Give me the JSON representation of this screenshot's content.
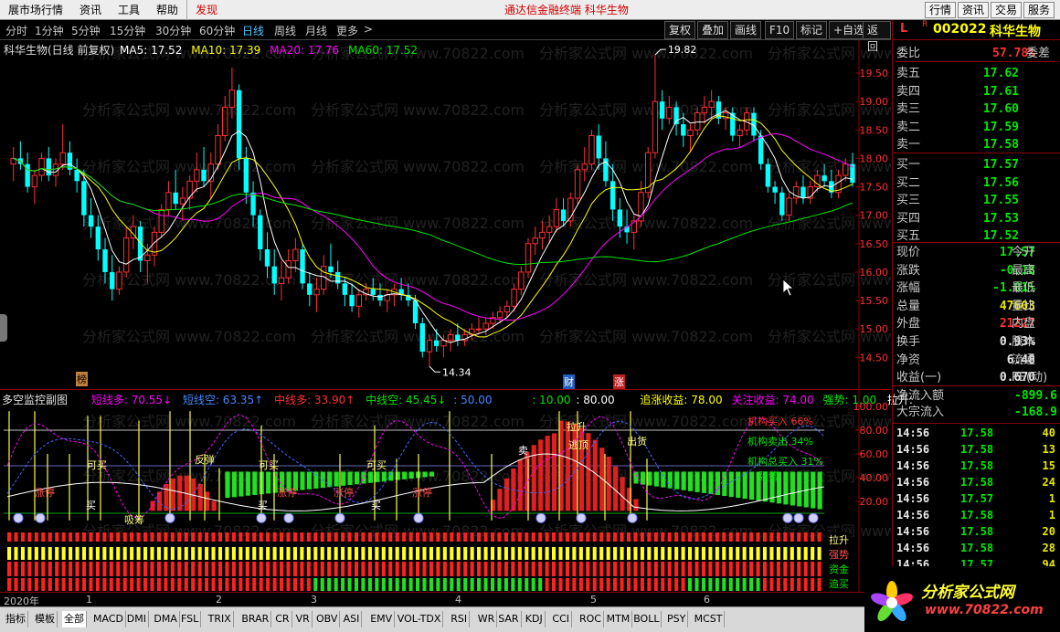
{
  "menubar": {
    "items": [
      "展市场行情",
      "资讯",
      "工具",
      "帮助"
    ],
    "discover": "发现",
    "center_title": "通达信金融终端   科华生物",
    "right_buttons": [
      "行情",
      "资讯",
      "交易",
      "服务"
    ]
  },
  "periods": {
    "items": [
      "分时",
      "1分钟",
      "5分钟",
      "15分钟",
      "30分钟",
      "60分钟",
      "日线",
      "周线",
      "月线",
      "更多"
    ],
    "active": "日线",
    "chevron": ">",
    "toolbar": [
      "复权",
      "叠加",
      "画线",
      "F10",
      "标记",
      "+自选",
      "返回"
    ]
  },
  "main_chart": {
    "title": "科华生物(日线 前复权)",
    "ma": [
      {
        "label": "MA5: 17.52",
        "color": "#ffffff"
      },
      {
        "label": "MA10: 17.39",
        "color": "#ffff00"
      },
      {
        "label": "MA20: 17.76",
        "color": "#ff00ff"
      },
      {
        "label": "MA60: 17.52",
        "color": "#00e600"
      }
    ],
    "max_label": "19.82",
    "min_label": "14.34",
    "y_ticks": [
      "19.50",
      "19.00",
      "18.50",
      "18.00",
      "17.50",
      "17.00",
      "16.50",
      "16.00",
      "15.50",
      "15.00",
      "14.50"
    ],
    "markers": [
      "榜",
      "财",
      "涨"
    ]
  },
  "chart_data": {
    "type": "candlestick",
    "title": "科华生物(日线 前复权)",
    "ylim": [
      14.2,
      19.95
    ],
    "y_ticks": [
      19.5,
      19.0,
      18.5,
      18.0,
      17.5,
      17.0,
      16.5,
      16.0,
      15.5,
      15.0,
      14.5
    ],
    "x_labels": [
      "2020年",
      "1",
      "2",
      "3",
      "4",
      "5",
      "6"
    ],
    "high": 19.82,
    "low": 14.34,
    "ohlc": [
      [
        17.9,
        18.2,
        17.6,
        18.0
      ],
      [
        18.0,
        18.3,
        17.8,
        17.9
      ],
      [
        17.9,
        18.1,
        17.4,
        17.5
      ],
      [
        17.5,
        17.8,
        17.2,
        17.7
      ],
      [
        17.7,
        18.1,
        17.6,
        18.0
      ],
      [
        18.0,
        18.2,
        17.6,
        17.7
      ],
      [
        17.7,
        18.0,
        17.5,
        17.9
      ],
      [
        17.9,
        18.6,
        17.8,
        18.1
      ],
      [
        18.1,
        18.3,
        17.7,
        17.8
      ],
      [
        17.8,
        18.0,
        17.4,
        17.6
      ],
      [
        17.6,
        17.8,
        16.8,
        17.0
      ],
      [
        17.0,
        17.3,
        16.6,
        16.8
      ],
      [
        16.8,
        17.0,
        16.2,
        16.4
      ],
      [
        16.4,
        16.6,
        15.8,
        16.0
      ],
      [
        16.0,
        16.3,
        15.5,
        15.7
      ],
      [
        15.7,
        16.1,
        15.6,
        16.0
      ],
      [
        16.0,
        16.8,
        15.9,
        16.6
      ],
      [
        16.6,
        17.0,
        16.4,
        16.8
      ],
      [
        16.8,
        16.9,
        16.0,
        16.2
      ],
      [
        16.2,
        16.5,
        15.8,
        16.3
      ],
      [
        16.3,
        16.8,
        16.1,
        16.7
      ],
      [
        16.7,
        17.2,
        16.6,
        17.1
      ],
      [
        17.1,
        17.6,
        17.0,
        17.4
      ],
      [
        17.4,
        17.8,
        17.1,
        17.2
      ],
      [
        17.2,
        17.5,
        16.9,
        17.3
      ],
      [
        17.3,
        17.7,
        17.1,
        17.6
      ],
      [
        17.6,
        18.1,
        17.4,
        17.8
      ],
      [
        17.8,
        18.2,
        17.5,
        17.6
      ],
      [
        17.6,
        18.1,
        17.3,
        17.9
      ],
      [
        17.9,
        18.6,
        17.8,
        18.4
      ],
      [
        18.4,
        19.1,
        18.3,
        18.9
      ],
      [
        18.9,
        19.6,
        18.7,
        19.2
      ],
      [
        19.2,
        19.3,
        17.8,
        18.0
      ],
      [
        18.0,
        18.2,
        17.2,
        17.4
      ],
      [
        17.4,
        17.6,
        16.8,
        17.0
      ],
      [
        17.0,
        17.1,
        16.2,
        16.4
      ],
      [
        16.4,
        16.7,
        15.9,
        16.1
      ],
      [
        16.1,
        16.4,
        15.6,
        15.8
      ],
      [
        15.8,
        16.2,
        15.5,
        15.9
      ],
      [
        15.9,
        16.4,
        15.8,
        16.2
      ],
      [
        16.2,
        16.6,
        16.0,
        16.4
      ],
      [
        16.4,
        16.5,
        15.7,
        15.8
      ],
      [
        15.8,
        16.0,
        15.4,
        15.6
      ],
      [
        15.6,
        15.9,
        15.3,
        15.7
      ],
      [
        15.7,
        16.3,
        15.6,
        16.1
      ],
      [
        16.1,
        16.5,
        15.9,
        16.0
      ],
      [
        16.0,
        16.2,
        15.7,
        15.8
      ],
      [
        15.8,
        15.9,
        15.4,
        15.6
      ],
      [
        15.6,
        15.8,
        15.3,
        15.4
      ],
      [
        15.4,
        15.7,
        15.2,
        15.6
      ],
      [
        15.6,
        15.8,
        15.5,
        15.7
      ],
      [
        15.7,
        15.9,
        15.5,
        15.6
      ],
      [
        15.6,
        15.8,
        15.4,
        15.5
      ],
      [
        15.5,
        15.7,
        15.3,
        15.6
      ],
      [
        15.6,
        15.8,
        15.4,
        15.7
      ],
      [
        15.7,
        15.9,
        15.5,
        15.6
      ],
      [
        15.6,
        15.8,
        15.4,
        15.5
      ],
      [
        15.5,
        15.6,
        15.0,
        15.1
      ],
      [
        15.1,
        15.2,
        14.5,
        14.6
      ],
      [
        14.6,
        14.9,
        14.34,
        14.8
      ],
      [
        14.8,
        15.0,
        14.6,
        14.7
      ],
      [
        14.7,
        14.9,
        14.5,
        14.8
      ],
      [
        14.8,
        15.0,
        14.6,
        14.9
      ],
      [
        14.9,
        15.1,
        14.7,
        14.8
      ],
      [
        14.8,
        15.0,
        14.7,
        14.9
      ],
      [
        14.9,
        15.1,
        14.8,
        15.0
      ],
      [
        15.0,
        15.2,
        14.9,
        15.0
      ],
      [
        15.0,
        15.2,
        14.9,
        15.1
      ],
      [
        15.1,
        15.3,
        15.0,
        15.2
      ],
      [
        15.2,
        15.4,
        15.1,
        15.3
      ],
      [
        15.3,
        15.5,
        15.2,
        15.4
      ],
      [
        15.4,
        15.8,
        15.3,
        15.7
      ],
      [
        15.7,
        16.1,
        15.6,
        16.0
      ],
      [
        16.0,
        16.6,
        15.9,
        16.5
      ],
      [
        16.5,
        16.8,
        16.3,
        16.6
      ],
      [
        16.6,
        16.9,
        16.4,
        16.7
      ],
      [
        16.7,
        17.0,
        16.5,
        16.8
      ],
      [
        16.8,
        17.3,
        16.7,
        17.1
      ],
      [
        17.1,
        17.3,
        16.8,
        16.9
      ],
      [
        16.9,
        17.4,
        16.8,
        17.3
      ],
      [
        17.3,
        17.9,
        17.2,
        17.8
      ],
      [
        17.8,
        18.2,
        17.6,
        17.9
      ],
      [
        17.9,
        18.5,
        17.8,
        18.4
      ],
      [
        18.4,
        18.6,
        17.8,
        18.0
      ],
      [
        18.0,
        18.3,
        17.5,
        17.6
      ],
      [
        17.6,
        17.9,
        16.9,
        17.1
      ],
      [
        17.1,
        17.3,
        16.6,
        16.8
      ],
      [
        16.8,
        17.1,
        16.5,
        16.7
      ],
      [
        16.7,
        17.0,
        16.4,
        16.9
      ],
      [
        16.9,
        17.6,
        16.8,
        17.4
      ],
      [
        17.4,
        18.2,
        17.3,
        18.1
      ],
      [
        18.1,
        19.82,
        18.0,
        19.0
      ],
      [
        19.0,
        19.2,
        18.5,
        18.7
      ],
      [
        18.7,
        19.1,
        18.6,
        18.9
      ],
      [
        18.9,
        19.0,
        18.4,
        18.6
      ],
      [
        18.6,
        18.8,
        18.2,
        18.4
      ],
      [
        18.4,
        18.6,
        18.1,
        18.5
      ],
      [
        18.5,
        18.9,
        18.4,
        18.8
      ],
      [
        18.8,
        19.1,
        18.6,
        18.9
      ],
      [
        18.9,
        19.2,
        18.7,
        19.0
      ],
      [
        19.0,
        19.1,
        18.6,
        18.7
      ],
      [
        18.7,
        18.9,
        18.5,
        18.8
      ],
      [
        18.8,
        18.9,
        18.3,
        18.4
      ],
      [
        18.4,
        18.6,
        18.2,
        18.5
      ],
      [
        18.5,
        18.9,
        18.4,
        18.8
      ],
      [
        18.8,
        18.9,
        18.3,
        18.4
      ],
      [
        18.4,
        18.5,
        17.8,
        17.9
      ],
      [
        17.9,
        18.0,
        17.4,
        17.5
      ],
      [
        17.5,
        17.6,
        17.2,
        17.4
      ],
      [
        17.4,
        17.5,
        16.9,
        17.0
      ],
      [
        17.0,
        17.4,
        16.9,
        17.3
      ],
      [
        17.3,
        17.6,
        17.2,
        17.5
      ],
      [
        17.5,
        17.7,
        17.2,
        17.3
      ],
      [
        17.3,
        17.6,
        17.2,
        17.5
      ],
      [
        17.5,
        17.8,
        17.4,
        17.7
      ],
      [
        17.7,
        17.9,
        17.5,
        17.6
      ],
      [
        17.6,
        17.8,
        17.3,
        17.4
      ],
      [
        17.4,
        17.8,
        17.3,
        17.7
      ],
      [
        17.7,
        18.0,
        17.6,
        17.9
      ],
      [
        17.9,
        18.1,
        17.5,
        17.57
      ]
    ]
  },
  "sub_chart": {
    "title": "多空监控副图",
    "legend": [
      {
        "label": "短线多: 70.55↓",
        "color": "#ff00ff"
      },
      {
        "label": "短线空: 63.35↑",
        "color": "#4488ff"
      },
      {
        "label": "中线多: 33.90↑",
        "color": "#ff3030"
      },
      {
        "label": "中线空: 45.45↓",
        "color": "#00e600"
      },
      {
        "label": ": 50.00",
        "color": "#4488ff"
      },
      {
        "label": ": 10.00",
        "color": "#00e600"
      },
      {
        "label": ": 80.00",
        "color": "#ffffff"
      },
      {
        "label": "追涨收益: 78.00",
        "color": "#ffff00"
      },
      {
        "label": "关注收益: 74.00",
        "color": "#ff00ff"
      },
      {
        "label": "强势: 1.00",
        "color": "#00e600"
      },
      {
        "label": "拉升:",
        "color": "#ffffff"
      }
    ],
    "y_ticks": [
      "100.00",
      "80.00",
      "60.00",
      "40.00",
      "20.00"
    ],
    "signals": {
      "zhangting": "涨停",
      "kemai": "可买",
      "mai": "买",
      "mai2": "卖",
      "fantan": "反弹",
      "xishou": "吸筹",
      "zhuizhang": "追涨",
      "chuhuo": "出货",
      "tiaozhan": "拉升",
      "baodi": "逃顶",
      "jigou_in": "机构买入 66%",
      "jigou_out": "机构卖出 34%",
      "jigou_total": "机构总买入 31%",
      "qiangshi": "强势",
      "zhangtan": "涨弹"
    },
    "right_labels": [
      "拉升",
      "强势",
      "资金",
      "追买"
    ]
  },
  "date_axis": [
    "2020年",
    "1",
    "2",
    "3",
    "4",
    "5",
    "6"
  ],
  "quote": {
    "code": "002022",
    "name": "科华生物",
    "flag_l": "L",
    "flag_r": "R",
    "weibi_label": "委比",
    "weibi_value": "57.78%",
    "weicha_label": "委差",
    "asks": [
      {
        "label": "卖五",
        "price": "17.62"
      },
      {
        "label": "卖四",
        "price": "17.61"
      },
      {
        "label": "卖三",
        "price": "17.60"
      },
      {
        "label": "卖二",
        "price": "17.59"
      },
      {
        "label": "卖一",
        "price": "17.58"
      }
    ],
    "bids": [
      {
        "label": "买一",
        "price": "17.57"
      },
      {
        "label": "买二",
        "price": "17.56"
      },
      {
        "label": "买三",
        "price": "17.55"
      },
      {
        "label": "买四",
        "price": "17.53"
      },
      {
        "label": "买五",
        "price": "17.52"
      }
    ],
    "stats": [
      {
        "label": "现价",
        "value": "17.57",
        "color": "#00e600",
        "label2": "今开"
      },
      {
        "label": "涨跌",
        "value": "-0.18",
        "color": "#00e600",
        "label2": "最高"
      },
      {
        "label": "涨幅",
        "value": "-1.01%",
        "color": "#00e600",
        "label2": "最低"
      },
      {
        "label": "总量",
        "value": "47603",
        "color": "#e8e800",
        "label2": "量比"
      },
      {
        "label": "外盘",
        "value": "21227",
        "color": "#ff3030",
        "label2": "内盘"
      },
      {
        "label": "换手",
        "value": "0.93%",
        "color": "#e8e8e8",
        "label2": "股本"
      },
      {
        "label": "净资",
        "value": "6.48",
        "color": "#e8e8e8",
        "label2": "流通"
      },
      {
        "label": "收益(一)",
        "value": "0.670",
        "color": "#e8e8e8",
        "label2": "PE(动)"
      }
    ],
    "flow": [
      {
        "label": "净流入额",
        "value": "-899.6"
      },
      {
        "label": "大宗流入",
        "value": "-168.9"
      }
    ],
    "ticks": [
      {
        "time": "14:56",
        "price": "17.58",
        "vol": "40"
      },
      {
        "time": "14:56",
        "price": "17.58",
        "vol": "13"
      },
      {
        "time": "14:56",
        "price": "17.58",
        "vol": "15"
      },
      {
        "time": "14:56",
        "price": "17.58",
        "vol": "24"
      },
      {
        "time": "14:56",
        "price": "17.57",
        "vol": "1"
      },
      {
        "time": "14:56",
        "price": "17.58",
        "vol": "1"
      },
      {
        "time": "14:56",
        "price": "17.58",
        "vol": "20"
      },
      {
        "time": "14:56",
        "price": "17.58",
        "vol": "28"
      },
      {
        "time": "14:56",
        "price": "17.57",
        "vol": "94"
      }
    ]
  },
  "bottom_tabs": [
    "指标",
    "模板",
    "全部",
    "MACD",
    "DMI",
    "DMA",
    "FSL",
    "TRIX",
    "BRAR",
    "CR",
    "VR",
    "OBV",
    "ASI",
    "EMV",
    "VOL-TDX",
    "RSI",
    "WR",
    "SAR",
    "KDJ",
    "CCI",
    "ROC",
    "MTM",
    "BOLL",
    "PSY",
    "MCST"
  ],
  "bottom_active": "全部",
  "watermark": "分析家公式网 www.70822.com",
  "logo": {
    "brand": "分析家公式网",
    "url": "www.70822.com"
  },
  "colors": {
    "up": "#ff3030",
    "down": "#00ffff",
    "ma5": "#ffffff",
    "ma10": "#ffff00",
    "ma20": "#ff00ff",
    "ma60": "#00e600"
  }
}
